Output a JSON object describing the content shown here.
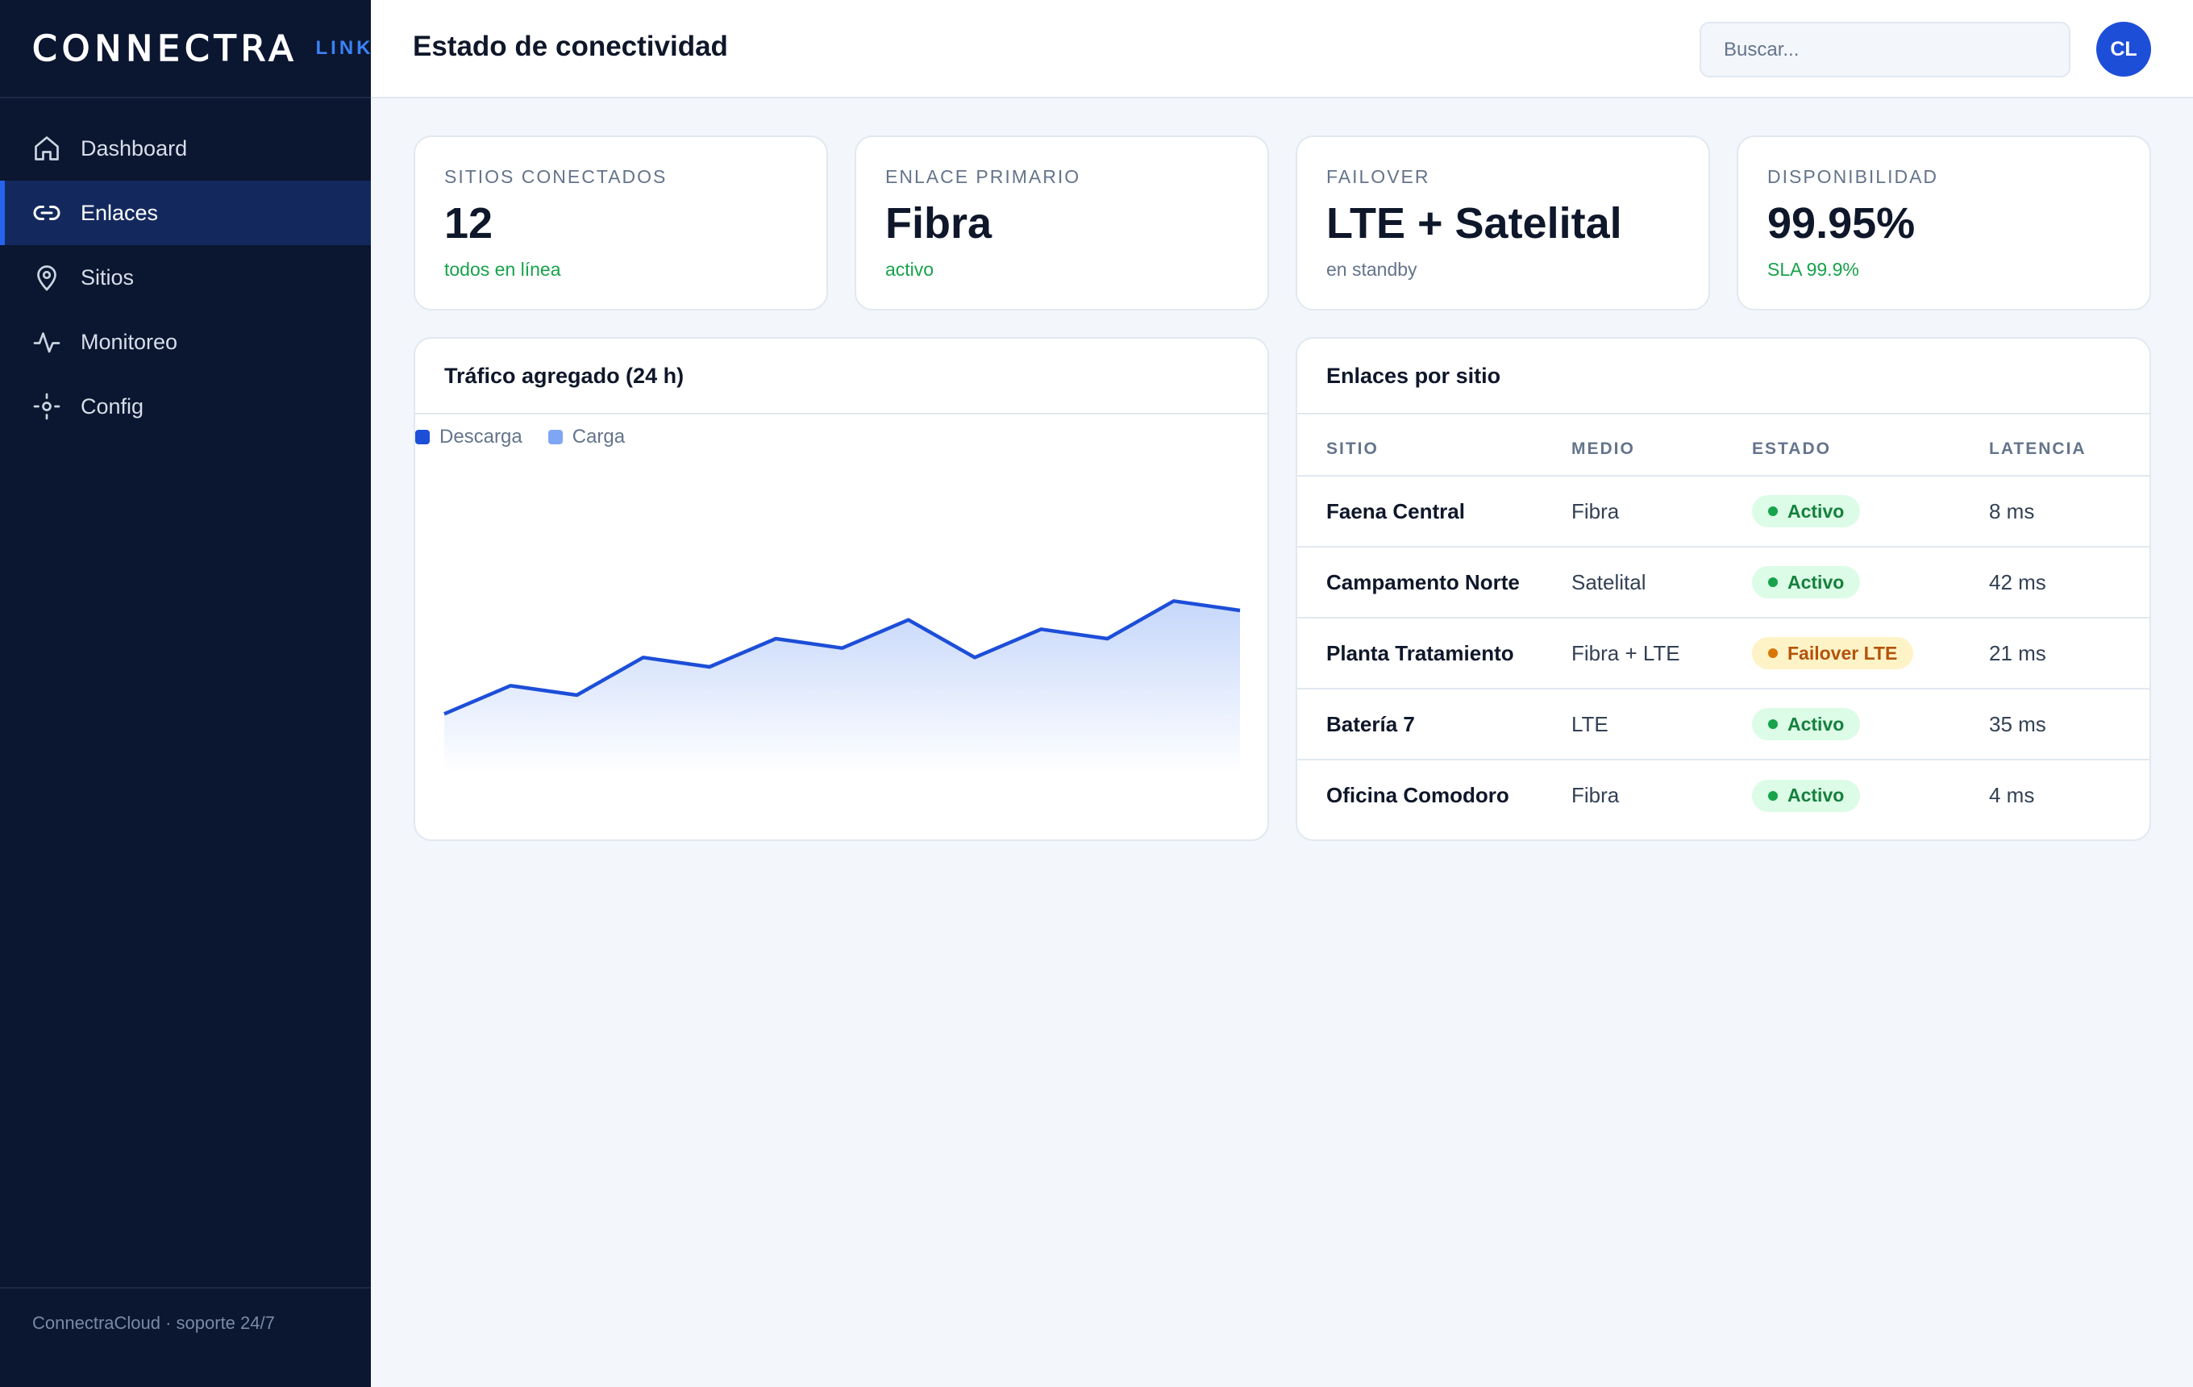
{
  "brand": {
    "logo": "CONNECTRA",
    "sub": "LINK"
  },
  "sidebar": {
    "items": [
      {
        "label": "Dashboard",
        "icon": "home-icon",
        "active": false
      },
      {
        "label": "Enlaces",
        "icon": "link-icon",
        "active": true
      },
      {
        "label": "Sitios",
        "icon": "map-pin-icon",
        "active": false
      },
      {
        "label": "Monitoreo",
        "icon": "activity-icon",
        "active": false
      },
      {
        "label": "Config",
        "icon": "settings-icon",
        "active": false
      }
    ],
    "footer": "ConnectraCloud · soporte 24/7"
  },
  "header": {
    "title": "Estado de conectividad",
    "search_placeholder": "Buscar...",
    "avatar": "CL"
  },
  "kpis": [
    {
      "label": "SITIOS CONECTADOS",
      "value": "12",
      "sub": "todos en línea",
      "sub_color": "green"
    },
    {
      "label": "ENLACE PRIMARIO",
      "value": "Fibra",
      "sub": "activo",
      "sub_color": "green"
    },
    {
      "label": "FAILOVER",
      "value": "LTE + Satelital",
      "sub": "en standby",
      "sub_color": "gray"
    },
    {
      "label": "DISPONIBILIDAD",
      "value": "99.95%",
      "sub": "SLA 99.9%",
      "sub_color": "green"
    }
  ],
  "traffic_panel": {
    "title": "Tráfico agregado (24 h)",
    "legend": [
      {
        "name": "Descarga",
        "color": "#1d4ed8"
      },
      {
        "name": "Carga",
        "color": "#7fa6f5"
      }
    ]
  },
  "chart_data": {
    "type": "area",
    "title": "Tráfico agregado (24 h)",
    "xlabel": "",
    "ylabel": "",
    "grid": false,
    "legend_position": "top-left",
    "x": [
      0,
      1,
      2,
      3,
      4,
      5,
      6,
      7,
      8,
      9,
      10,
      11,
      12
    ],
    "series": [
      {
        "name": "Descarga",
        "color": "#1d4ed8",
        "values": [
          32,
          47,
          42,
          62,
          57,
          72,
          67,
          82,
          62,
          77,
          72,
          92,
          87
        ]
      }
    ],
    "ylim": [
      0,
      120
    ]
  },
  "links_panel": {
    "title": "Enlaces por sitio",
    "columns": [
      "SITIO",
      "MEDIO",
      "ESTADO",
      "LATENCIA"
    ],
    "rows": [
      {
        "site": "Faena Central",
        "medio": "Fibra",
        "estado": "Activo",
        "status": "ok",
        "latencia": "8 ms"
      },
      {
        "site": "Campamento Norte",
        "medio": "Satelital",
        "estado": "Activo",
        "status": "ok",
        "latencia": "42 ms"
      },
      {
        "site": "Planta Tratamiento",
        "medio": "Fibra + LTE",
        "estado": "Failover LTE",
        "status": "warn",
        "latencia": "21 ms"
      },
      {
        "site": "Batería 7",
        "medio": "LTE",
        "estado": "Activo",
        "status": "ok",
        "latencia": "35 ms"
      },
      {
        "site": "Oficina Comodoro",
        "medio": "Fibra",
        "estado": "Activo",
        "status": "ok",
        "latencia": "4 ms"
      }
    ]
  }
}
